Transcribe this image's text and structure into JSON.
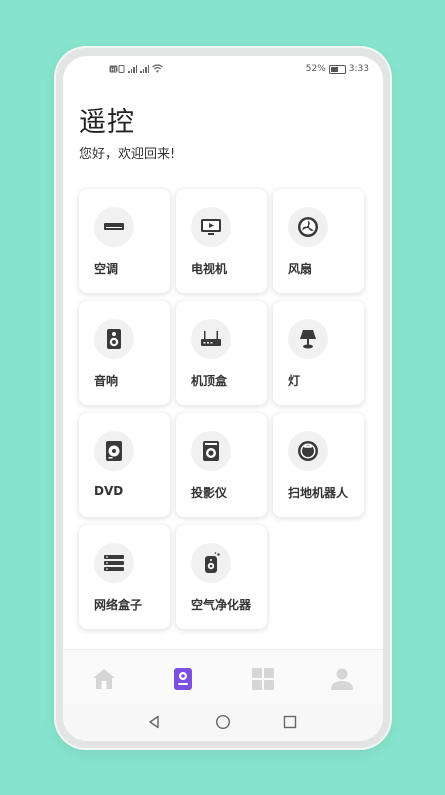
{
  "status_bar": {
    "left_icons": [
      "hd-icon",
      "signal-icon",
      "signal-icon",
      "wifi-icon"
    ],
    "battery_percent": "52%",
    "time": "3:33"
  },
  "header": {
    "title": "遥控",
    "subtitle": "您好，欢迎回来!"
  },
  "devices": [
    {
      "label": "空调",
      "icon": "air-conditioner-icon"
    },
    {
      "label": "电视机",
      "icon": "tv-icon"
    },
    {
      "label": "风扇",
      "icon": "fan-icon"
    },
    {
      "label": "音响",
      "icon": "speaker-icon"
    },
    {
      "label": "机顶盒",
      "icon": "set-top-box-icon"
    },
    {
      "label": "灯",
      "icon": "lamp-icon"
    },
    {
      "label": "DVD",
      "icon": "dvd-icon"
    },
    {
      "label": "投影仪",
      "icon": "projector-icon"
    },
    {
      "label": "扫地机器人",
      "icon": "robot-vacuum-icon"
    },
    {
      "label": "网络盒子",
      "icon": "network-box-icon"
    },
    {
      "label": "空气净化器",
      "icon": "air-purifier-icon"
    }
  ],
  "tab_bar": {
    "tabs": [
      {
        "icon": "home-icon",
        "active": false
      },
      {
        "icon": "remote-icon",
        "active": true
      },
      {
        "icon": "grid-icon",
        "active": false
      },
      {
        "icon": "user-icon",
        "active": false
      }
    ],
    "active_color": "#7b4fe0",
    "inactive_color": "#d6d6d6"
  },
  "nav_bar": {
    "buttons": [
      "back-icon",
      "home-circle-icon",
      "recents-icon"
    ]
  },
  "colors": {
    "background": "#86e3cc",
    "card_icon_bg": "#f1f1f1",
    "icon_dark": "#3a3a3a"
  }
}
